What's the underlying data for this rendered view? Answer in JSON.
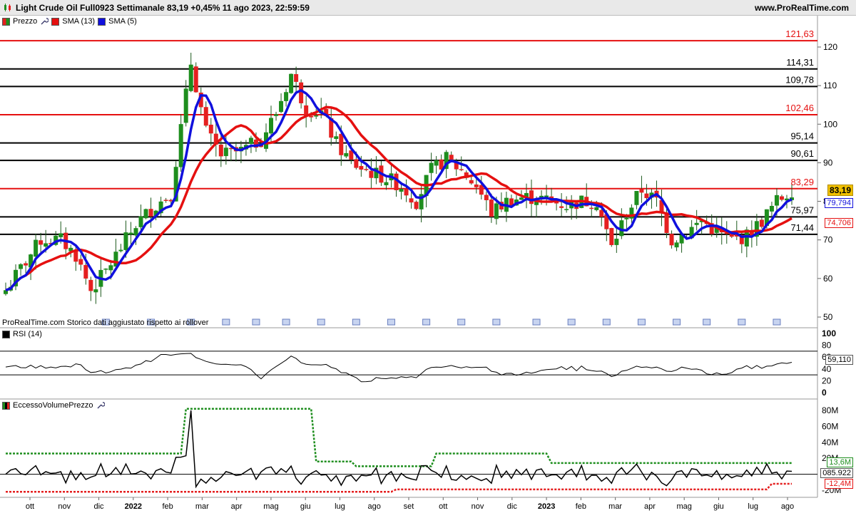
{
  "header": {
    "title": "Light Crude Oil Full0923 Settimanale 83,19 +0,45% 11 ago 2023, 22:59:59",
    "site": "www.ProRealTime.com"
  },
  "price_panel": {
    "legend": {
      "price": "Prezzo",
      "sma13": "SMA (13)",
      "sma5": "SMA (5)"
    },
    "footer_note": "ProRealTime.com  Storico dati aggiustato rispetto ai rollover",
    "current_price_tag": "83,19",
    "sma5_tag": "79,794",
    "sma13_tag": "74,706",
    "colors": {
      "up": "#1e8e1e",
      "down": "#e52020",
      "sma13": "#e51010",
      "sma5": "#1010dd",
      "tag_price": "#f0c000"
    }
  },
  "rsi_panel": {
    "legend": "RSI (14)",
    "value_tag": "59,110",
    "ticks": [
      "100",
      "80",
      "60",
      "40",
      "20",
      "0"
    ]
  },
  "evp_panel": {
    "legend": "EccessoVolumePrezzo",
    "ticks": [
      "80M",
      "60M",
      "40M",
      "20M",
      "0",
      "-20M"
    ],
    "tags": {
      "upper": "13,6M",
      "value": "085.922",
      "lower": "-12,4M"
    }
  },
  "x_axis": {
    "labels": [
      "ott",
      "nov",
      "dic",
      "2022",
      "feb",
      "mar",
      "apr",
      "mag",
      "giu",
      "lug",
      "ago",
      "set",
      "ott",
      "nov",
      "dic",
      "2023",
      "feb",
      "mar",
      "apr",
      "mag",
      "giu",
      "lug",
      "ago"
    ]
  },
  "chart_data": [
    {
      "type": "candlestick",
      "title": "Light Crude Oil Full0923 Settimanale",
      "y_axis_ticks": [
        120,
        110,
        100,
        90,
        80,
        70,
        60,
        50
      ],
      "ylim": [
        50,
        122
      ],
      "horizontal_levels": [
        {
          "value": 121.63,
          "label": "121,63",
          "color": "#e51010"
        },
        {
          "value": 114.31,
          "label": "114,31",
          "color": "#000000"
        },
        {
          "value": 109.78,
          "label": "109,78",
          "color": "#000000"
        },
        {
          "value": 102.46,
          "label": "102,46",
          "color": "#e51010"
        },
        {
          "value": 95.14,
          "label": "95,14",
          "color": "#000000"
        },
        {
          "value": 90.61,
          "label": "90,61",
          "color": "#000000"
        },
        {
          "value": 83.29,
          "label": "83,29",
          "color": "#e51010"
        },
        {
          "value": 75.97,
          "label": "75,97",
          "color": "#000000"
        },
        {
          "value": 71.44,
          "label": "71,44",
          "color": "#000000"
        }
      ],
      "last_close": 83.19,
      "sma5_last": 79.794,
      "sma13_last": 74.706
    },
    {
      "type": "line",
      "title": "RSI (14)",
      "ylim": [
        0,
        100
      ],
      "levels": [
        70,
        30
      ],
      "last": 59.11
    },
    {
      "type": "line",
      "title": "EccessoVolumePrezzo",
      "ylim": [
        -20,
        85
      ],
      "upper_band_last": 13.6,
      "lower_band_last": -12.4,
      "last_value": 0.85922
    }
  ]
}
